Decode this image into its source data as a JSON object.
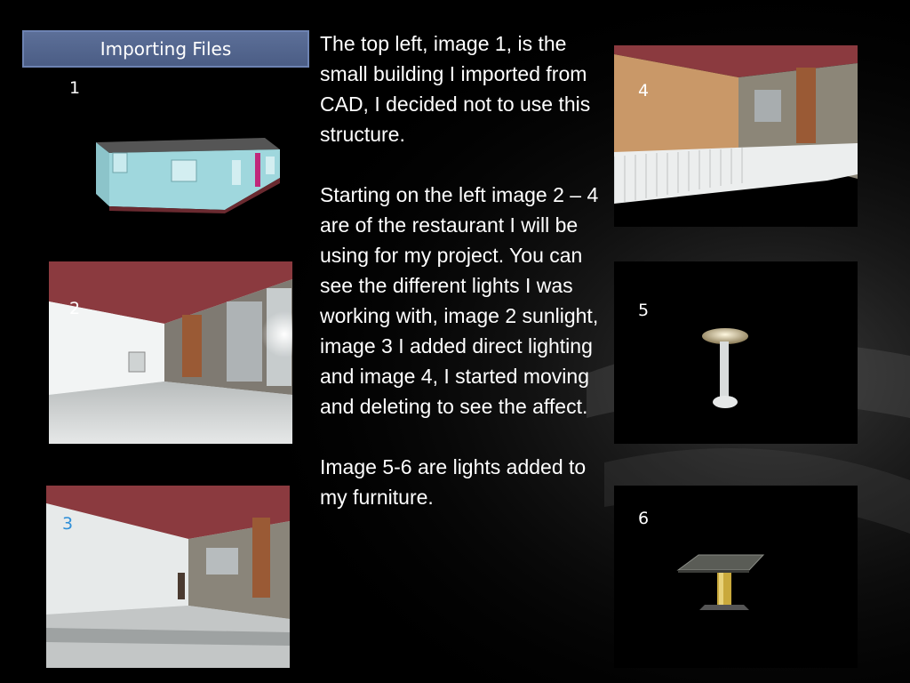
{
  "slide": {
    "title": "Importing Files",
    "paragraphs": [
      "The top left, image 1,  is the small building I imported from CAD, I decided not to use this structure.",
      "Starting on the left image 2 – 4 are of the restaurant I will be using for my project. You can see the different lights I was working with, image 2 sunlight, image 3 I added direct lighting and image 4, I started moving and deleting to see the affect.",
      "Image 5-6 are lights added to my furniture."
    ]
  },
  "images": [
    {
      "label": "1"
    },
    {
      "label": "2"
    },
    {
      "label": "3",
      "label_color": "#2f8fd8"
    },
    {
      "label": "4"
    },
    {
      "label": "5"
    },
    {
      "label": "6"
    }
  ],
  "colors": {
    "background": "#000000",
    "title_fill": "#56698f",
    "ceiling": "#8b3a3f",
    "building_wall": "#9ed6dc"
  }
}
